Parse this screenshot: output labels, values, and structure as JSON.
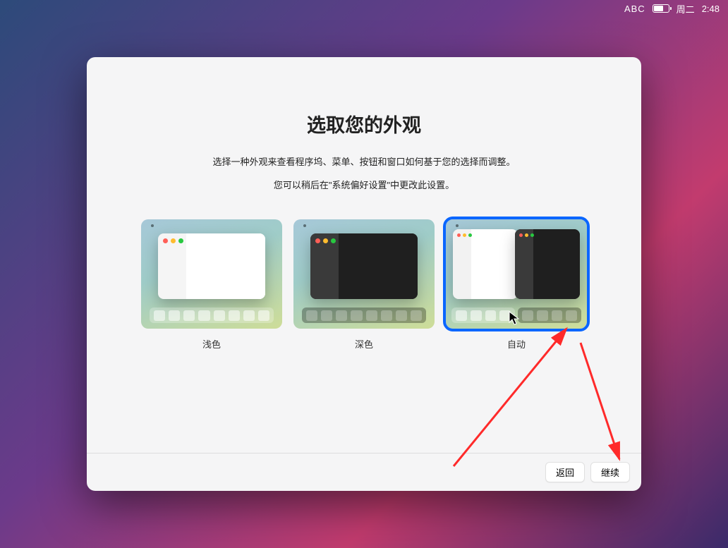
{
  "menubar": {
    "input_label": "ABC",
    "day": "周二",
    "time": "2:48"
  },
  "dialog": {
    "title": "选取您的外观",
    "subtitle": "选择一种外观来查看程序坞、菜单、按钮和窗口如何基于您的选择而调整。",
    "subtitle2": "您可以稍后在\"系统偏好设置\"中更改此设置。"
  },
  "options": [
    {
      "key": "light",
      "label": "浅色"
    },
    {
      "key": "dark",
      "label": "深色"
    },
    {
      "key": "auto",
      "label": "自动"
    }
  ],
  "selected_option": "auto",
  "buttons": {
    "back": "返回",
    "continue": "继续"
  },
  "annotation_color": "#ff2a2a"
}
